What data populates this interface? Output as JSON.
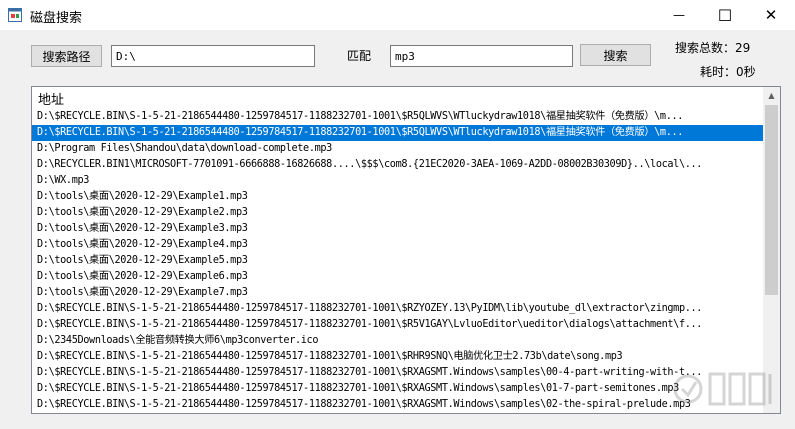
{
  "window": {
    "title": "磁盘搜索",
    "minimize_glyph": "—",
    "maximize_glyph": "☐",
    "close_glyph": "✕"
  },
  "controls": {
    "path_button": "搜索路径",
    "path_value": "D:\\",
    "match_label": "匹配",
    "match_value": "mp3",
    "search_button": "搜索",
    "total_label": "搜索总数：29",
    "time_label": "耗时：0秒"
  },
  "results": {
    "header": "地址",
    "selected_index": 1,
    "rows": [
      "D:\\$RECYCLE.BIN\\S-1-5-21-2186544480-1259784517-1188232701-1001\\$R5QLWVS\\WTluckydraw1018\\福星抽奖软件（免费版）\\m...",
      "D:\\$RECYCLE.BIN\\S-1-5-21-2186544480-1259784517-1188232701-1001\\$R5QLWVS\\WTluckydraw1018\\福星抽奖软件（免费版）\\m...",
      "D:\\Program Files\\Shandou\\data\\download-complete.mp3",
      "D:\\RECYCLER.BIN1\\MICROSOFT-7701091-6666888-16826688....\\$$$\\com8.{21EC2020-3AEA-1069-A2DD-08002B30309D}..\\local\\...",
      "D:\\WX.mp3",
      "D:\\tools\\桌面\\2020-12-29\\Example1.mp3",
      "D:\\tools\\桌面\\2020-12-29\\Example2.mp3",
      "D:\\tools\\桌面\\2020-12-29\\Example3.mp3",
      "D:\\tools\\桌面\\2020-12-29\\Example4.mp3",
      "D:\\tools\\桌面\\2020-12-29\\Example5.mp3",
      "D:\\tools\\桌面\\2020-12-29\\Example6.mp3",
      "D:\\tools\\桌面\\2020-12-29\\Example7.mp3",
      "D:\\$RECYCLE.BIN\\S-1-5-21-2186544480-1259784517-1188232701-1001\\$RZYOZEY.13\\PyIDM\\lib\\youtube_dl\\extractor\\zingmp...",
      "D:\\$RECYCLE.BIN\\S-1-5-21-2186544480-1259784517-1188232701-1001\\$R5V1GAY\\LvluoEditor\\ueditor\\dialogs\\attachment\\f...",
      "D:\\2345Downloads\\全能音频转换大师6\\mp3converter.ico",
      "D:\\$RECYCLE.BIN\\S-1-5-21-2186544480-1259784517-1188232701-1001\\$RHR9SNQ\\电脑优化卫士2.73b\\date\\song.mp3",
      "D:\\$RECYCLE.BIN\\S-1-5-21-2186544480-1259784517-1188232701-1001\\$RXAGSMT.Windows\\samples\\00-4-part-writing-with-t...",
      "D:\\$RECYCLE.BIN\\S-1-5-21-2186544480-1259784517-1188232701-1001\\$RXAGSMT.Windows\\samples\\01-7-part-semitones.mp3",
      "D:\\$RECYCLE.BIN\\S-1-5-21-2186544480-1259784517-1188232701-1001\\$RXAGSMT.Windows\\samples\\02-the-spiral-prelude.mp3"
    ]
  },
  "colors": {
    "selection": "#0078d7",
    "window_bg": "#f0f0f0"
  },
  "icons": {
    "app": "app-window-icon",
    "scroll_up": "scroll-up-arrow-icon"
  }
}
